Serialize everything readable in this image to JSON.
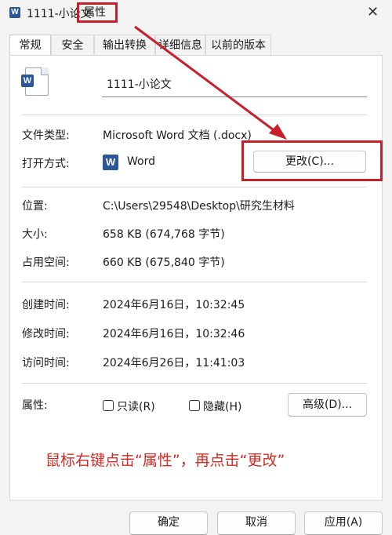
{
  "window": {
    "title_file": "1111-小论文",
    "title_suffix": "属性",
    "close_glyph": "✕"
  },
  "tabs": [
    {
      "label": "常规",
      "active": true
    },
    {
      "label": "安全",
      "active": false
    },
    {
      "label": "输出转换",
      "active": false
    },
    {
      "label": "详细信息",
      "active": false
    },
    {
      "label": "以前的版本",
      "active": false
    }
  ],
  "general": {
    "filename": "1111-小论文",
    "file_type_label": "文件类型:",
    "file_type_value": "Microsoft Word 文档 (.docx)",
    "open_with_label": "打开方式:",
    "open_with_value": "Word",
    "change_button": "更改(C)...",
    "location_label": "位置:",
    "location_value": "C:\\Users\\29548\\Desktop\\研究生材料",
    "size_label": "大小:",
    "size_value": "658 KB (674,768 字节)",
    "disk_size_label": "占用空间:",
    "disk_size_value": "660 KB (675,840 字节)",
    "created_label": "创建时间:",
    "created_value": "2024年6月16日，10:32:45",
    "modified_label": "修改时间:",
    "modified_value": "2024年6月16日，10:32:46",
    "accessed_label": "访问时间:",
    "accessed_value": "2024年6月26日，11:41:03",
    "attributes_label": "属性:",
    "readonly_label": "只读(R)",
    "hidden_label": "隐藏(H)",
    "advanced_button": "高级(D)..."
  },
  "annotation": "鼠标右键点击“属性”，再点击“更改”",
  "footer": {
    "ok": "确定",
    "cancel": "取消",
    "apply": "应用(A)"
  },
  "colors": {
    "highlight_red": "#c8202a",
    "annotation_red": "#d42a24",
    "word_blue": "#2b579a"
  }
}
